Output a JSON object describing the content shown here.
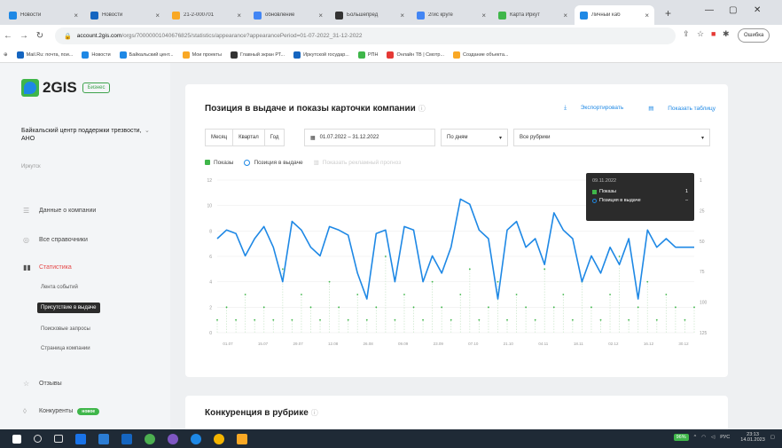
{
  "browser": {
    "tabs": [
      {
        "label": "Новости",
        "color": "#1e88e5"
      },
      {
        "label": "Новости",
        "color": "#1565c0"
      },
      {
        "label": "21-2-000701",
        "color": "#f9a825"
      },
      {
        "label": "обновление",
        "color": "#4285f4"
      },
      {
        "label": "Большепред",
        "color": "#333333"
      },
      {
        "label": "2гис круге",
        "color": "#4285f4"
      },
      {
        "label": "Карта Иркут",
        "color": "#3fb64a"
      },
      {
        "label": "Личный каб",
        "color": "#1e88e5"
      }
    ],
    "new_tab": "+",
    "url_host": "account.2gis.com",
    "url_path": "/orgs/70000001040676825/statistics/appearance?appearancePeriod=01-07-2022_31-12-2022",
    "error_button": "Ошибка",
    "bookmarks": [
      {
        "label": "Mail.Ru: почта, пои...",
        "color": "#1565c0"
      },
      {
        "label": "Новости",
        "color": "#1e88e5"
      },
      {
        "label": "Байкальский цент...",
        "color": "#1e88e5"
      },
      {
        "label": "Мои проекты",
        "color": "#f9a825"
      },
      {
        "label": "Главный экран РТ...",
        "color": "#333333"
      },
      {
        "label": "Иркутской государ...",
        "color": "#1565c0"
      },
      {
        "label": "РПН",
        "color": "#3fb64a"
      },
      {
        "label": "Онлайн ТВ | Смотр...",
        "color": "#e53935"
      },
      {
        "label": "Создание объекта...",
        "color": "#f9a825"
      }
    ]
  },
  "sidebar": {
    "logo": "2GIS",
    "logo_badge": "Бизнес",
    "company": "Байкальский центр поддержки трезвости, АНО",
    "city": "Иркутск",
    "nav": [
      {
        "label": "Данные о компании",
        "icon": "list-icon"
      },
      {
        "label": "Все справочники",
        "icon": "globe-icon"
      },
      {
        "label": "Статистика",
        "icon": "chart-icon"
      }
    ],
    "subnav": [
      {
        "label": "Лента событий"
      },
      {
        "label": "Присутствие в выдаче"
      },
      {
        "label": "Поисковые запросы"
      },
      {
        "label": "Страница компании"
      }
    ],
    "reviews": "Отзывы",
    "competitors": "Конкуренты",
    "competitors_badge": "новое"
  },
  "main": {
    "title": "Позиция в выдаче и показы карточки компании",
    "export": "Экспортировать",
    "show_table": "Показать таблицу",
    "filters": {
      "periods": [
        "Месяц",
        "Квартал",
        "Год"
      ],
      "date_range": "01.07.2022 – 31.12.2022",
      "granularity": "По дням",
      "rubric": "Все рубрики"
    },
    "legend": {
      "impressions": "Показы",
      "position": "Позиция в выдаче",
      "forecast": "Показать рекламный прогноз"
    },
    "tooltip": {
      "date": "09.11.2022",
      "impressions_label": "Показы",
      "impressions_value": "1",
      "position_label": "Позиция в выдаче",
      "position_value": "–"
    },
    "competition_title": "Конкуренция в рубрике"
  },
  "chart_data": {
    "type": "line",
    "x_ticks": [
      "01.07",
      "15.07",
      "29.07",
      "12.08",
      "26.08",
      "09.09",
      "23.09",
      "07.10",
      "21.10",
      "04.11",
      "18.11",
      "02.12",
      "16.12",
      "30.12"
    ],
    "y_left_ticks": [
      "0",
      "2",
      "4",
      "6",
      "8",
      "10",
      "12"
    ],
    "y_right_ticks": [
      "125",
      "100",
      "75",
      "50",
      "25",
      "1"
    ],
    "series": [
      {
        "name": "Позиция в выдаче",
        "color": "#1e88e5",
        "values": [
          35,
          30,
          32,
          45,
          35,
          28,
          40,
          60,
          25,
          30,
          40,
          45,
          28,
          30,
          33,
          55,
          70,
          32,
          30,
          60,
          28,
          30,
          60,
          45,
          55,
          40,
          12,
          15,
          30,
          35,
          70,
          30,
          25,
          40,
          35,
          50,
          20,
          30,
          35,
          60,
          45,
          55,
          40,
          50,
          35,
          70,
          30,
          40,
          35,
          40,
          40,
          40
        ]
      },
      {
        "name": "Показы",
        "color": "#3fb64a",
        "values": [
          1,
          2,
          1,
          3,
          1,
          2,
          1,
          5,
          1,
          3,
          2,
          1,
          4,
          2,
          1,
          3,
          1,
          2,
          6,
          1,
          3,
          2,
          1,
          4,
          2,
          1,
          3,
          5,
          1,
          2,
          4,
          1,
          3,
          2,
          1,
          5,
          2,
          3,
          1,
          4,
          2,
          1,
          3,
          6,
          1,
          2,
          4,
          1,
          3,
          2,
          1,
          2
        ]
      }
    ]
  },
  "taskbar": {
    "tray_items": [
      "РУС"
    ],
    "battery": "96%",
    "time": "23:13",
    "date": "14.01.2023"
  }
}
